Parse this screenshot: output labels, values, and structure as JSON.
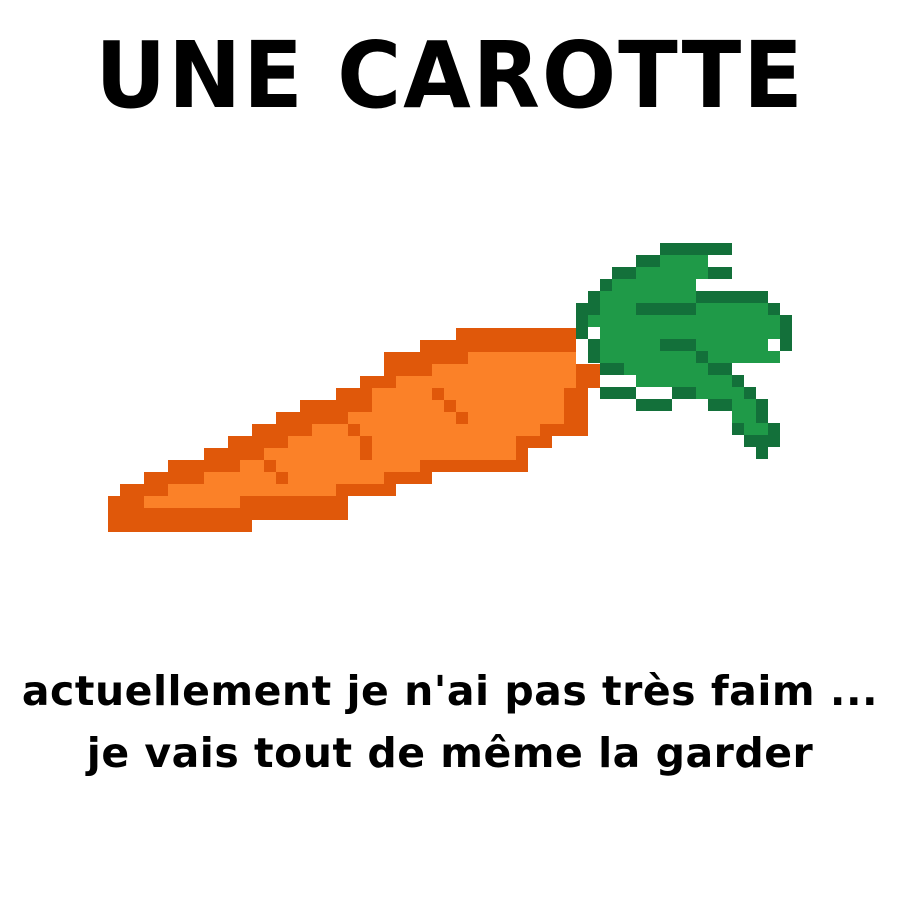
{
  "title": "UNE CAROTTE",
  "item": {
    "icon": "carrot-icon",
    "colors": {
      "outline": "#e0580a",
      "body": "#fb8128",
      "leaf_dark": "#13703a",
      "leaf_light": "#1f9a48"
    }
  },
  "caption": {
    "line1": "actuellement je n'ai pas très faim ...",
    "line2": "je vais tout de même la garder"
  }
}
